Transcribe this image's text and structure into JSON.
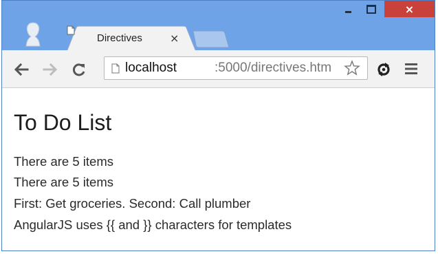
{
  "window": {
    "minimize_icon": "minimize-icon",
    "maximize_icon": "maximize-icon",
    "close_glyph": "×",
    "frame_color": "#6fa3e8",
    "close_color": "#c9413b"
  },
  "tabs": [
    {
      "title": "Directives",
      "close_glyph": "×",
      "icon": "page-icon"
    }
  ],
  "toolbar": {
    "back_icon": "back-arrow-icon",
    "forward_icon": "forward-arrow-icon",
    "reload_icon": "reload-icon",
    "url_host": "localhost",
    "url_path": ":5000/directives.htm",
    "bookmark_icon": "star-icon",
    "extension_icon": "sync-icon",
    "menu_icon": "hamburger-menu-icon"
  },
  "page": {
    "title": "To Do List",
    "lines": [
      "There are 5 items",
      "There are 5 items",
      "First: Get groceries. Second: Call plumber",
      "AngularJS uses {{ and }} characters for templates"
    ]
  }
}
